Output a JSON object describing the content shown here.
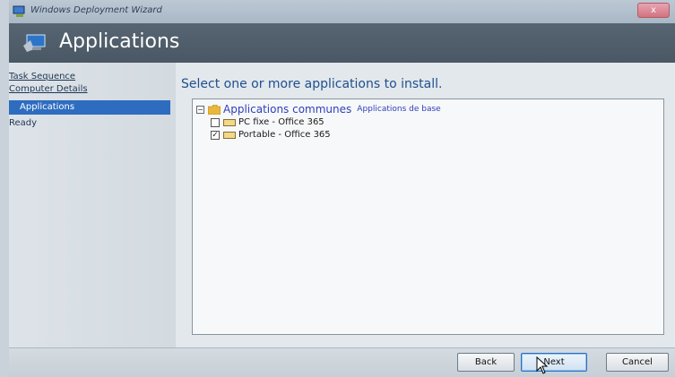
{
  "window": {
    "title": "Windows Deployment Wizard",
    "close_glyph": "x"
  },
  "header": {
    "title": "Applications"
  },
  "nav": {
    "items": [
      {
        "label": "Task Sequence",
        "state": "link"
      },
      {
        "label": "Computer Details",
        "state": "link"
      },
      {
        "label": "Applications",
        "state": "selected"
      },
      {
        "label": "Ready",
        "state": "plain"
      }
    ]
  },
  "main": {
    "prompt": "Select one or more applications to install.",
    "tree": {
      "group": {
        "label": "Applications communes",
        "description": "Applications de base",
        "expander": "⊟"
      },
      "apps": [
        {
          "label": "PC fixe - Office 365",
          "checked": false
        },
        {
          "label": "Portable - Office 365",
          "checked": true
        }
      ]
    }
  },
  "buttons": {
    "back": "Back",
    "next": "Next",
    "cancel": "Cancel"
  },
  "colors": {
    "header_bg": "#4f5e6a",
    "selection": "#2e6cc0",
    "prompt_text": "#1f4f8f",
    "group_text": "#2e3fbb"
  },
  "icons": {
    "title": "wizard-computer-icon",
    "header": "computer-monitor-icon",
    "group": "folder-icon",
    "app": "application-icon",
    "pointer": "mouse-cursor-icon"
  }
}
